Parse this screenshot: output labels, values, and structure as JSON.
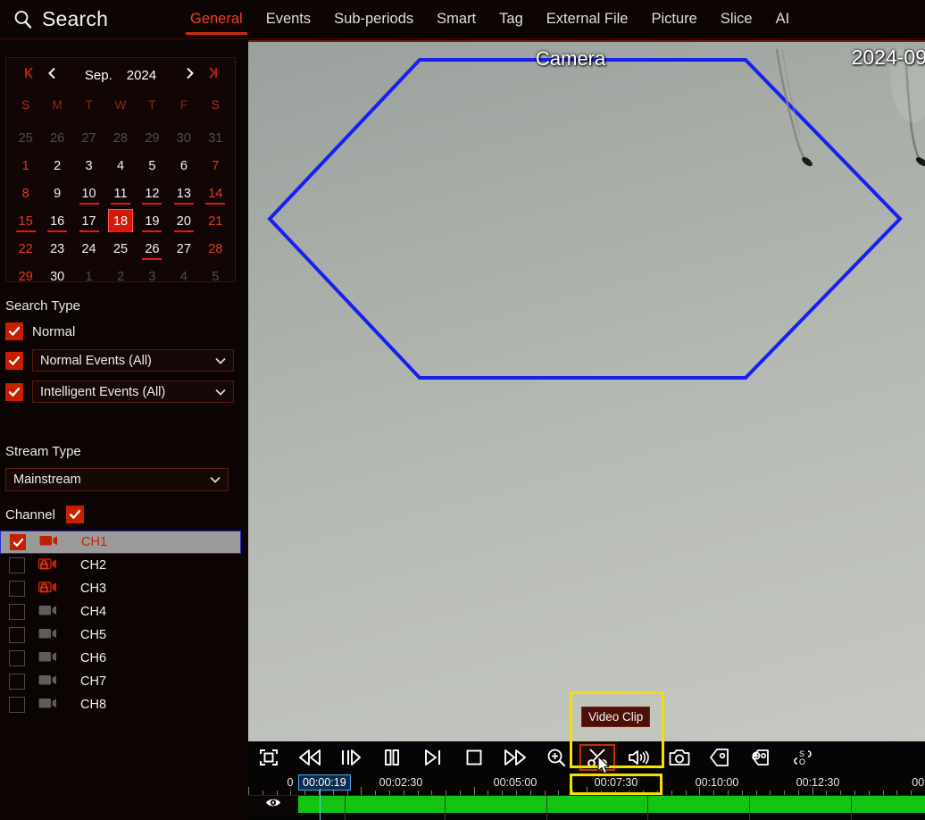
{
  "app": {
    "title": "Search",
    "search_icon": "magnifier-icon"
  },
  "tabs": [
    {
      "label": "General",
      "active": true
    },
    {
      "label": "Events",
      "active": false
    },
    {
      "label": "Sub-periods",
      "active": false
    },
    {
      "label": "Smart",
      "active": false
    },
    {
      "label": "Tag",
      "active": false
    },
    {
      "label": "External File",
      "active": false
    },
    {
      "label": "Picture",
      "active": false
    },
    {
      "label": "Slice",
      "active": false
    },
    {
      "label": "AI",
      "active": false
    }
  ],
  "calendar": {
    "month": "Sep.",
    "year": "2024",
    "nav": {
      "first": "|<",
      "prev": "<",
      "next": ">",
      "last": ">|"
    },
    "dow": [
      "S",
      "M",
      "T",
      "W",
      "T",
      "F",
      "S"
    ],
    "selected_day": 18,
    "days_with_recordings": [
      10,
      11,
      12,
      13,
      14,
      15,
      16,
      17,
      18,
      19,
      20,
      26
    ],
    "weeks": [
      [
        {
          "d": "25",
          "m": true
        },
        {
          "d": "26",
          "m": true
        },
        {
          "d": "27",
          "m": true
        },
        {
          "d": "28",
          "m": true
        },
        {
          "d": "29",
          "m": true
        },
        {
          "d": "30",
          "m": true
        },
        {
          "d": "31",
          "m": true
        }
      ],
      [
        {
          "d": "1"
        },
        {
          "d": "2"
        },
        {
          "d": "3"
        },
        {
          "d": "4"
        },
        {
          "d": "5"
        },
        {
          "d": "6"
        },
        {
          "d": "7"
        }
      ],
      [
        {
          "d": "8"
        },
        {
          "d": "9"
        },
        {
          "d": "10"
        },
        {
          "d": "11"
        },
        {
          "d": "12"
        },
        {
          "d": "13"
        },
        {
          "d": "14"
        }
      ],
      [
        {
          "d": "15"
        },
        {
          "d": "16"
        },
        {
          "d": "17"
        },
        {
          "d": "18"
        },
        {
          "d": "19"
        },
        {
          "d": "20"
        },
        {
          "d": "21"
        }
      ],
      [
        {
          "d": "22"
        },
        {
          "d": "23"
        },
        {
          "d": "24"
        },
        {
          "d": "25"
        },
        {
          "d": "26"
        },
        {
          "d": "27"
        },
        {
          "d": "28"
        }
      ],
      [
        {
          "d": "29"
        },
        {
          "d": "30"
        },
        {
          "d": "1",
          "m": true
        },
        {
          "d": "2",
          "m": true
        },
        {
          "d": "3",
          "m": true
        },
        {
          "d": "4",
          "m": true
        },
        {
          "d": "5",
          "m": true
        }
      ]
    ]
  },
  "search_type": {
    "label": "Search Type",
    "normal": {
      "label": "Normal",
      "checked": true
    },
    "normal_events": {
      "value": "Normal Events (All)",
      "checked": true
    },
    "intelligent_events": {
      "value": "Intelligent Events (All)",
      "checked": true
    }
  },
  "stream_type": {
    "label": "Stream Type",
    "value": "Mainstream"
  },
  "channel": {
    "label": "Channel",
    "all_checked": true,
    "items": [
      {
        "name": "CH1",
        "checked": true,
        "selected": true,
        "icon": "camera-icon",
        "icon_state": "active"
      },
      {
        "name": "CH2",
        "checked": false,
        "selected": false,
        "icon": "camera-locked-icon",
        "icon_state": "locked"
      },
      {
        "name": "CH3",
        "checked": false,
        "selected": false,
        "icon": "camera-locked-icon",
        "icon_state": "locked"
      },
      {
        "name": "CH4",
        "checked": false,
        "selected": false,
        "icon": "camera-icon",
        "icon_state": "offline"
      },
      {
        "name": "CH5",
        "checked": false,
        "selected": false,
        "icon": "camera-icon",
        "icon_state": "offline"
      },
      {
        "name": "CH6",
        "checked": false,
        "selected": false,
        "icon": "camera-icon",
        "icon_state": "offline"
      },
      {
        "name": "CH7",
        "checked": false,
        "selected": false,
        "icon": "camera-icon",
        "icon_state": "offline"
      },
      {
        "name": "CH8",
        "checked": false,
        "selected": false,
        "icon": "camera-icon",
        "icon_state": "offline"
      }
    ]
  },
  "video": {
    "camera_label": "Camera",
    "timestamp": "2024-09",
    "overlay_shape": "hexagon",
    "overlay_color": "#1820ee"
  },
  "controls": {
    "tooltip": "Video Clip",
    "buttons": [
      {
        "name": "fullscreen-button",
        "icon": "fullscreen-icon"
      },
      {
        "name": "rewind-button",
        "icon": "rewind-icon"
      },
      {
        "name": "slow-forward-button",
        "icon": "frame-step-icon"
      },
      {
        "name": "pause-button",
        "icon": "pause-icon"
      },
      {
        "name": "next-frame-button",
        "icon": "next-frame-icon"
      },
      {
        "name": "stop-button",
        "icon": "stop-icon"
      },
      {
        "name": "fast-forward-button",
        "icon": "fast-forward-icon"
      },
      {
        "name": "digital-zoom-button",
        "icon": "zoom-in-icon"
      },
      {
        "name": "video-clip-button",
        "icon": "scissors-icon",
        "highlighted": true
      },
      {
        "name": "volume-button",
        "icon": "speaker-icon"
      },
      {
        "name": "snapshot-button",
        "icon": "camera-shutter-icon"
      },
      {
        "name": "tag-button",
        "icon": "tag-icon"
      },
      {
        "name": "add-tag-button",
        "icon": "add-tag-icon"
      },
      {
        "name": "smart-search-button",
        "icon": "smart-search-icon"
      }
    ]
  },
  "timeline": {
    "current_time": "00:00:19",
    "start_label": "0",
    "ticks": [
      {
        "label": "00:02:30",
        "pos": 0.225
      },
      {
        "label": "00:05:00",
        "pos": 0.395
      },
      {
        "label": "00:07:30",
        "pos": 0.543
      },
      {
        "label": "00:10:00",
        "pos": 0.693
      },
      {
        "label": "00:12:30",
        "pos": 0.842
      },
      {
        "label": "00:",
        "pos": 0.992
      }
    ],
    "track_icon": "eye-icon",
    "recording_color": "#13c413",
    "playhead_pos": 0.106,
    "highlight_tick": "00:07:30"
  }
}
